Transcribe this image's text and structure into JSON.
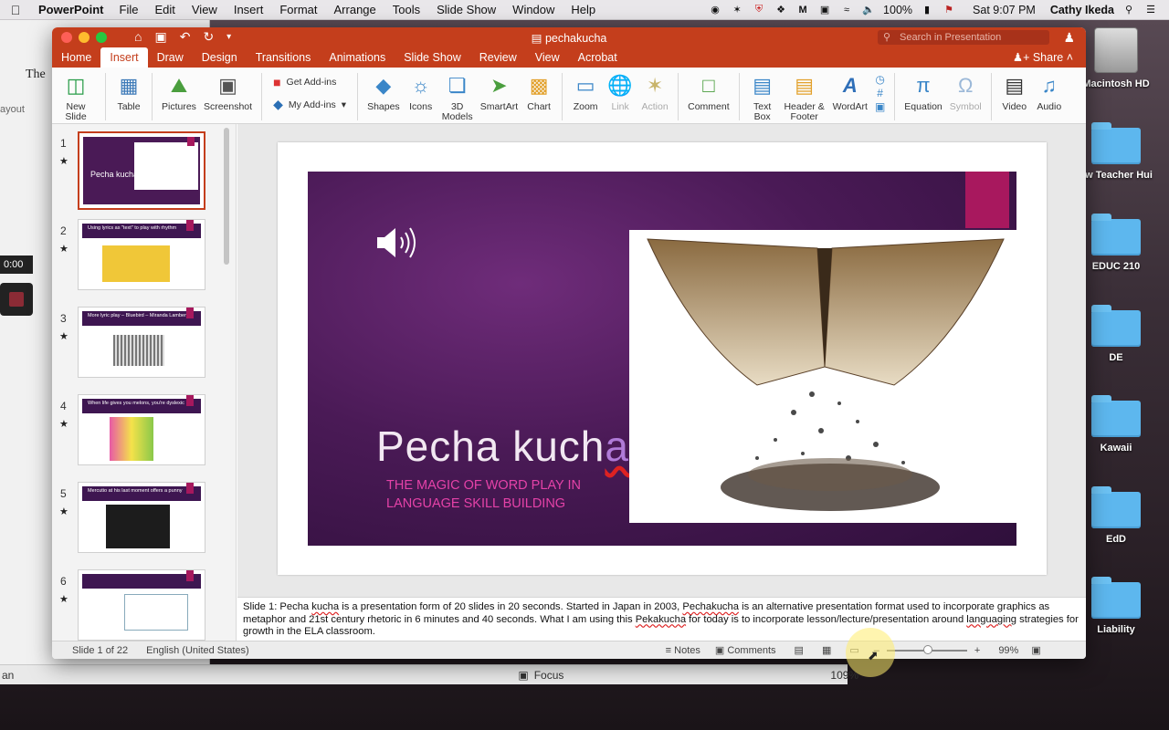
{
  "menubar": {
    "app": "PowerPoint",
    "items": [
      "File",
      "Edit",
      "View",
      "Insert",
      "Format",
      "Arrange",
      "Tools",
      "Slide Show",
      "Window",
      "Help"
    ],
    "battery": "100%",
    "clock": "Sat 9:07 PM",
    "user": "Cathy Ikeda"
  },
  "backwin": {
    "snippet": "The",
    "layout": "ayout",
    "timer": "0:00",
    "lang": "an",
    "focus": "Focus",
    "zoom": "109%"
  },
  "desktop": [
    {
      "label": "Macintosh HD",
      "type": "hdd"
    },
    {
      "label": "ew Teacher Hui",
      "type": "folder"
    },
    {
      "label": "EDUC 210",
      "type": "folder"
    },
    {
      "label": "DE",
      "type": "folder"
    },
    {
      "label": "Kawaii",
      "type": "folder"
    },
    {
      "label": "EdD",
      "type": "folder"
    },
    {
      "label": "Liability",
      "type": "folder"
    }
  ],
  "window": {
    "title": "pechakucha",
    "search_placeholder": "Search in Presentation"
  },
  "tabs": [
    "Home",
    "Insert",
    "Draw",
    "Design",
    "Transitions",
    "Animations",
    "Slide Show",
    "Review",
    "View",
    "Acrobat"
  ],
  "share": "Share",
  "ribbon": {
    "new_slide": "New Slide",
    "table": "Table",
    "pictures": "Pictures",
    "screenshot": "Screenshot",
    "get_addins": "Get Add-ins",
    "my_addins": "My Add-ins",
    "shapes": "Shapes",
    "icons": "Icons",
    "models_3d": "3D Models",
    "smartart": "SmartArt",
    "chart": "Chart",
    "zoom": "Zoom",
    "link": "Link",
    "action": "Action",
    "comment": "Comment",
    "text_box": "Text Box",
    "header_footer": "Header & Footer",
    "wordart": "WordArt",
    "equation": "Equation",
    "symbol": "Symbol",
    "video": "Video",
    "audio": "Audio"
  },
  "thumbnails": [
    {
      "n": "1",
      "title": "Pecha kucha"
    },
    {
      "n": "2",
      "title": "Using lyrics as \"text\" to play with rhythm"
    },
    {
      "n": "3",
      "title": "More lyric play – Bluebird – Miranda Lambert"
    },
    {
      "n": "4",
      "title": "When life gives you melons, you're dyslexic"
    },
    {
      "n": "5",
      "title": "Mercutio at his last moment offers a punny"
    },
    {
      "n": "6",
      "title": ""
    }
  ],
  "slide": {
    "title_main": "Pecha kuch",
    "title_last": "a",
    "subtitle": "THE MAGIC OF WORD PLAY IN LANGUAGE SKILL BUILDING"
  },
  "notes": {
    "p1": "Slide 1: Pecha ",
    "w1": "kucha",
    "p2": " is a presentation form of 20 slides in 20 seconds. Started in Japan in 2003, ",
    "w2": "Pechakucha",
    "p3": " is an alternative presentation format used to incorporate graphics as metaphor and 21st century rhetoric in 6 minutes and 40 seconds. What I am using this ",
    "w3": "Pekakucha",
    "p4": " for today is to incorporate lesson/lecture/presentation around ",
    "w4": "languaging",
    "p5": " strategies for growth in the ELA classroom."
  },
  "status": {
    "slide": "Slide 1 of 22",
    "lang": "English (United States)",
    "notes": "Notes",
    "comments": "Comments",
    "zoom": "99%"
  },
  "colors": {
    "accent": "#c43e1c",
    "slide_bg": "#4a1a56",
    "slide_accent": "#a8185e",
    "subtitle": "#e542a8"
  }
}
